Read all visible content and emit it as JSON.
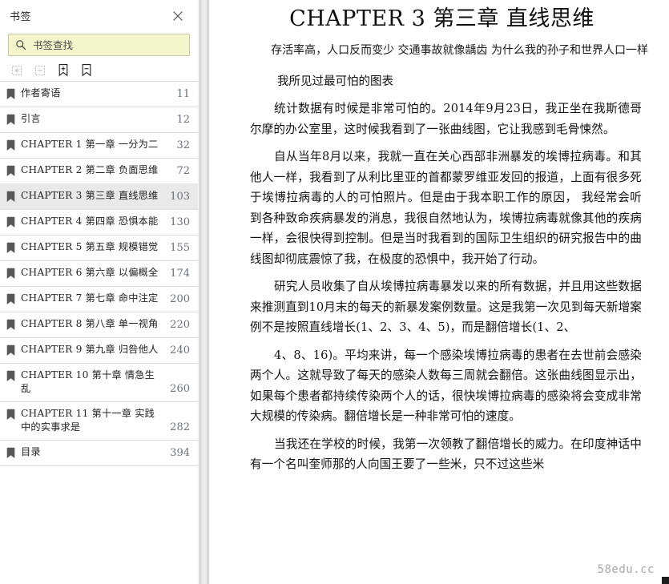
{
  "sidebar": {
    "title": "书签",
    "close_icon": "close-icon",
    "search": {
      "icon": "search-icon",
      "placeholder": "书签查找",
      "value": "",
      "background": "#f5f5cb",
      "border": "#c9c9a8"
    },
    "toolbar": [
      {
        "name": "expand-all-button",
        "icon": "expand-plus-box-icon",
        "label": "展开全部",
        "enabled": false
      },
      {
        "name": "collapse-all-button",
        "icon": "collapse-minus-box-icon",
        "label": "收起全部",
        "enabled": false
      },
      {
        "name": "add-bookmark-button",
        "icon": "bookmark-plus-icon",
        "label": "添加书签",
        "enabled": true
      },
      {
        "name": "remove-bookmark-button",
        "icon": "bookmark-minus-icon",
        "label": "删除书签",
        "enabled": true
      }
    ],
    "items": [
      {
        "label": "作者寄语",
        "page": "11",
        "selected": false
      },
      {
        "label": "引言",
        "page": "12",
        "selected": false
      },
      {
        "label": "CHAPTER 1  第一章  一分为二",
        "page": "32",
        "selected": false
      },
      {
        "label": "CHAPTER 2  第二章  负面思维",
        "page": "72",
        "selected": false
      },
      {
        "label": "CHAPTER 3  第三章  直线思维",
        "page": "103",
        "selected": true
      },
      {
        "label": "CHAPTER 4  第四章  恐惧本能",
        "page": "130",
        "selected": false
      },
      {
        "label": "CHAPTER 5  第五章  规模错觉",
        "page": "155",
        "selected": false
      },
      {
        "label": "CHAPTER 6  第六章  以偏概全",
        "page": "174",
        "selected": false
      },
      {
        "label": "CHAPTER 7  第七章  命中注定",
        "page": "200",
        "selected": false
      },
      {
        "label": "CHAPTER 8  第八章  单一视角",
        "page": "220",
        "selected": false
      },
      {
        "label": "CHAPTER 9  第九章  归咎他人",
        "page": "240",
        "selected": false
      },
      {
        "label": "CHAPTER 10  第十章  情急生乱",
        "page": "260",
        "selected": false
      },
      {
        "label": "CHAPTER 11  第十一章  实践中的实事求是",
        "page": "282",
        "selected": false
      },
      {
        "label": "目录",
        "page": "394",
        "selected": false
      }
    ],
    "selection_color": "#e9e9e9",
    "page_number_color": "#6b7280"
  },
  "document": {
    "title": "CHAPTER 3 第三章  直线思维",
    "subtitle": "存活率高，人口反而变少 交通事故就像龋齿 为什么我的孙子和世界人口一样",
    "heading": "我所见过最可怕的图表",
    "paragraphs": [
      "统计数据有时候是非常可怕的。2014年9月23日，我正坐在我斯德哥尔摩的办公室里，这时候我看到了一张曲线图，它让我感到毛骨悚然。",
      "自从当年8月以来，我就一直在关心西部非洲暴发的埃博拉病毒。和其他人一样，我看到了从利比里亚的首都蒙罗维亚发回的报道，上面有很多死于埃博拉病毒的人的可怕照片。但是由于我本职工作的原因， 我经常会听到各种致命疾病暴发的消息，我很自然地认为，埃博拉病毒就像其他的疾病一样，会很快得到控制。但是当时我看到的国际卫生组织的研究报告中的曲线图却彻底震惊了我，在极度的恐惧中，我开始了行动。",
      "研究人员收集了自从埃博拉病毒暴发以来的所有数据，并且用这些数据来推测直到10月末的每天的新暴发案例数量。这是我第一次见到每天新增案例不是按照直线增长(1、2、3、4、5)，而是翻倍增长(1、2、",
      "4、8、16)。平均来讲，每一个感染埃博拉病毒的患者在去世前会感染两个人。这就导致了每天的感染人数每三周就会翻倍。这张曲线图显示出，如果每个患者都持续传染两个人的话，很快埃博拉病毒的感染将会变成非常大规模的传染病。翻倍增长是一种非常可怕的速度。",
      "当我还在学校的时候，我第一次领教了翻倍增长的威力。在印度神话中有一个名叫奎师那的人向国王要了一些米，只不过这些米"
    ],
    "watermark": "58edu.cc"
  }
}
